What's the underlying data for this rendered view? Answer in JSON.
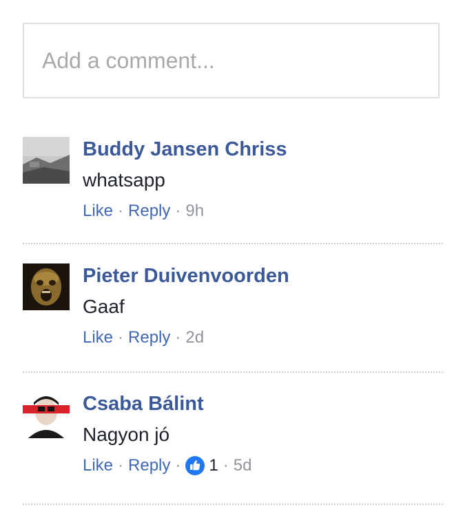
{
  "composer": {
    "placeholder": "Add a comment..."
  },
  "comments": [
    {
      "author": "Buddy Jansen Chriss",
      "text": "whatsapp",
      "like_label": "Like",
      "reply_label": "Reply",
      "time": "9h"
    },
    {
      "author": "Pieter Duivenvoorden",
      "text": "Gaaf",
      "like_label": "Like",
      "reply_label": "Reply",
      "time": "2d"
    },
    {
      "author": "Csaba Bálint",
      "text": "Nagyon jó",
      "like_label": "Like",
      "reply_label": "Reply",
      "likes": "1",
      "time": "5d"
    }
  ],
  "separator": "·",
  "colors": {
    "link": "#3b5998",
    "action_link": "#4267b2",
    "meta": "#90949c",
    "text": "#1d2129",
    "like_badge": "#2078f4"
  },
  "icons": {
    "like": "thumbs-up-icon"
  }
}
